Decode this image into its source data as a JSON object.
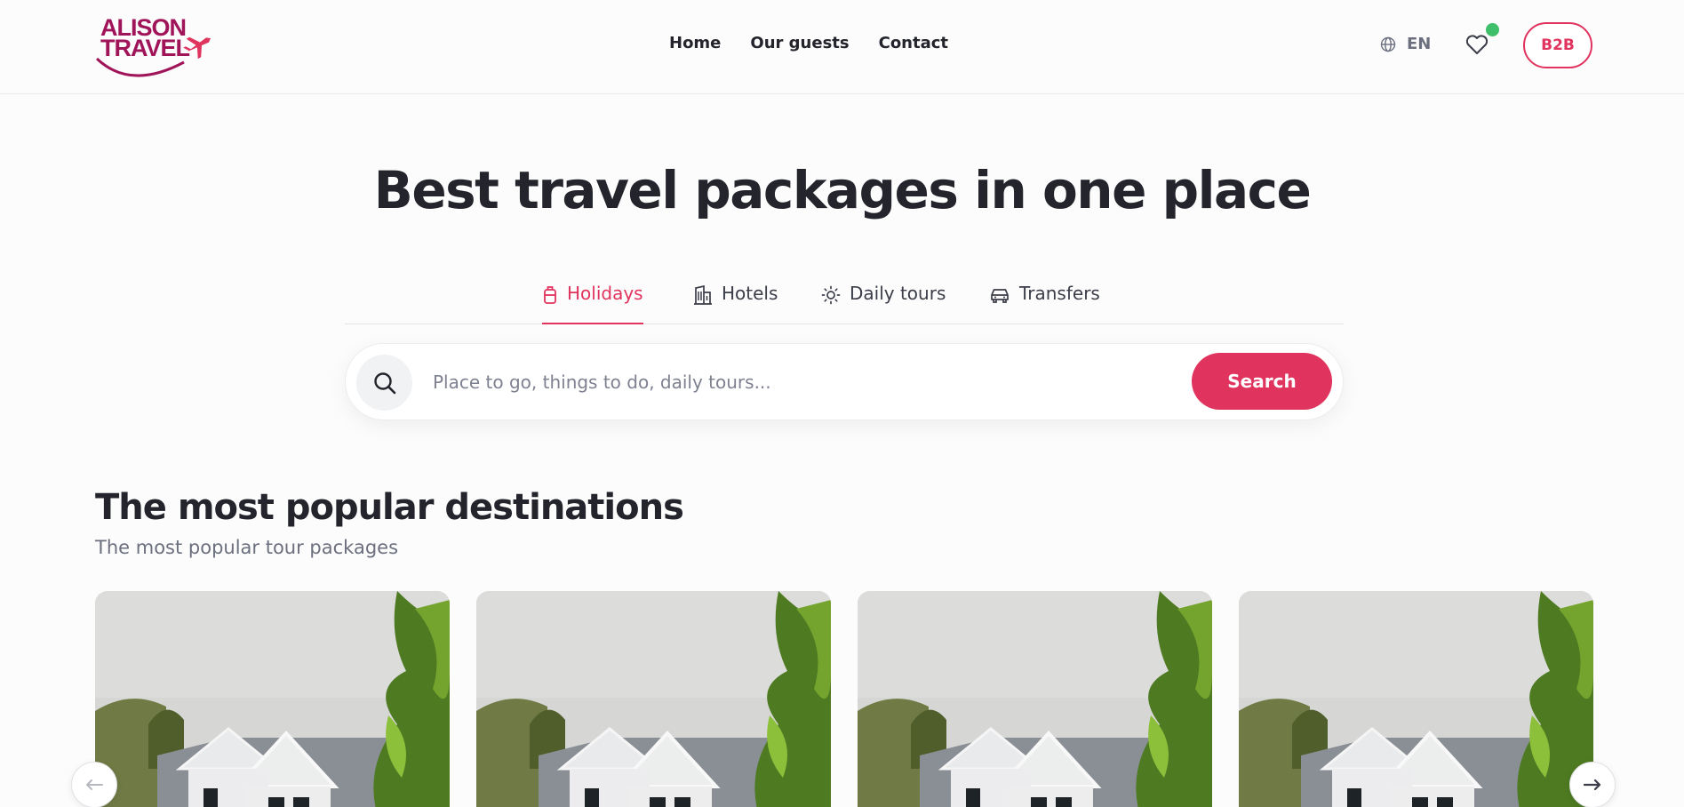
{
  "header": {
    "logo_line1": "ALISON",
    "logo_line2": "TRAVEL",
    "nav": [
      "Home",
      "Our guests",
      "Contact"
    ],
    "language": "EN",
    "b2b_label": "B2B"
  },
  "hero": {
    "title": "Best travel packages in one place"
  },
  "tabs": [
    {
      "label": "Holidays",
      "icon": "suitcase-icon",
      "active": true
    },
    {
      "label": "Hotels",
      "icon": "building-icon",
      "active": false
    },
    {
      "label": "Daily tours",
      "icon": "sun-icon",
      "active": false
    },
    {
      "label": "Transfers",
      "icon": "car-icon",
      "active": false
    }
  ],
  "search": {
    "placeholder": "Place to go, things to do, daily tours...",
    "button_label": "Search"
  },
  "section": {
    "title": "The most popular destinations",
    "subtitle": "The most popular tour packages"
  },
  "colors": {
    "accent": "#e0335e",
    "brand": "#a0145a",
    "online_dot": "#3fbf6a",
    "text": "#23242c"
  }
}
